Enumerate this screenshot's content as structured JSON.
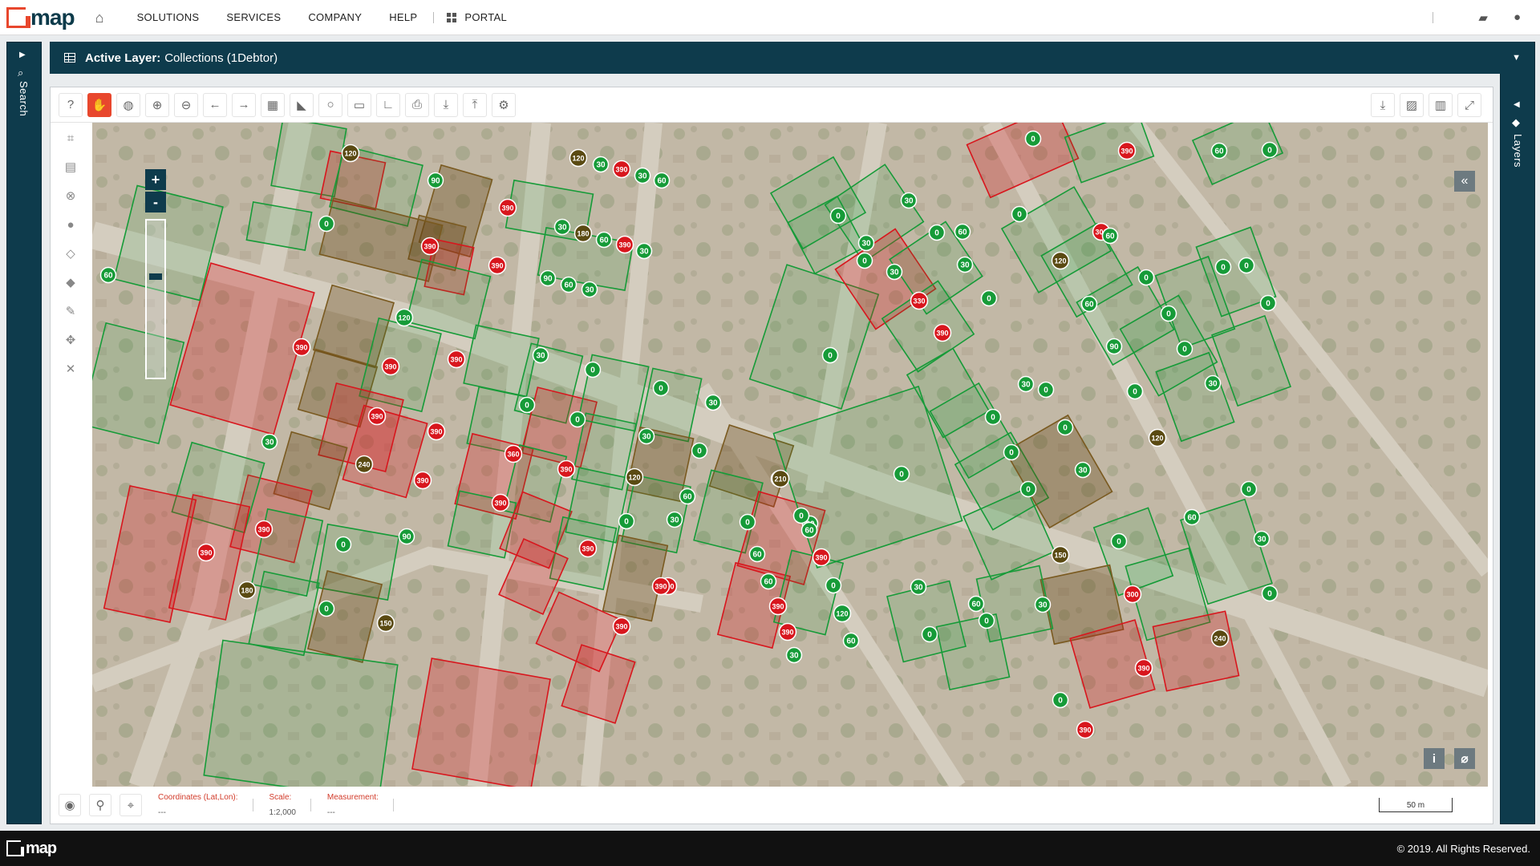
{
  "brand": {
    "name": "map"
  },
  "nav": {
    "items": [
      "SOLUTIONS",
      "SERVICES",
      "COMPANY",
      "HELP"
    ],
    "portal": "PORTAL"
  },
  "icons": {
    "home": "home-icon",
    "portal": "grid-icon",
    "chat": "chat-icon",
    "user": "user-icon",
    "search": "search-icon",
    "layers": "layers-icon"
  },
  "panels": {
    "search_label": "Search",
    "layers_label": "Layers"
  },
  "active_layer": {
    "prefix": "Active Layer:",
    "name": "Collections (1Debtor)"
  },
  "statusbar": {
    "coords_label": "Coordinates (Lat,Lon):",
    "coords_value": "---",
    "scale_label": "Scale:",
    "scale_value": "1:2,000",
    "measure_label": "Measurement:",
    "measure_value": "---",
    "scalebar_label": "50 m"
  },
  "footer": {
    "copyright": "© 2019. All Rights Reserved."
  },
  "colors": {
    "accent": "#e8472d",
    "panel": "#0e3b4c",
    "green": "#169b38",
    "red": "#d8161d",
    "olive": "#5a4a12"
  },
  "markers": [
    {
      "v": "120",
      "c": "o"
    },
    {
      "v": "0",
      "c": "g"
    },
    {
      "v": "90",
      "c": "g"
    },
    {
      "v": "390",
      "c": "r"
    },
    {
      "v": "390",
      "c": "r"
    },
    {
      "v": "390",
      "c": "r"
    },
    {
      "v": "120",
      "c": "o"
    },
    {
      "v": "30",
      "c": "g"
    },
    {
      "v": "390",
      "c": "r"
    },
    {
      "v": "30",
      "c": "g"
    },
    {
      "v": "60",
      "c": "g"
    },
    {
      "v": "30",
      "c": "g"
    },
    {
      "v": "180",
      "c": "o"
    },
    {
      "v": "60",
      "c": "g"
    },
    {
      "v": "390",
      "c": "r"
    },
    {
      "v": "30",
      "c": "g"
    },
    {
      "v": "90",
      "c": "g"
    },
    {
      "v": "60",
      "c": "g"
    },
    {
      "v": "30",
      "c": "g"
    },
    {
      "v": "60",
      "c": "g"
    },
    {
      "v": "120",
      "c": "g"
    },
    {
      "v": "390",
      "c": "r"
    },
    {
      "v": "390",
      "c": "r"
    },
    {
      "v": "390",
      "c": "r"
    },
    {
      "v": "30",
      "c": "g"
    },
    {
      "v": "0",
      "c": "g"
    },
    {
      "v": "0",
      "c": "g"
    },
    {
      "v": "0",
      "c": "g"
    },
    {
      "v": "390",
      "c": "r"
    },
    {
      "v": "30",
      "c": "g"
    },
    {
      "v": "390",
      "c": "r"
    },
    {
      "v": "360",
      "c": "r"
    },
    {
      "v": "390",
      "c": "r"
    },
    {
      "v": "240",
      "c": "o"
    },
    {
      "v": "390",
      "c": "r"
    },
    {
      "v": "0",
      "c": "g"
    },
    {
      "v": "30",
      "c": "g"
    },
    {
      "v": "390",
      "c": "r"
    },
    {
      "v": "30",
      "c": "g"
    },
    {
      "v": "0",
      "c": "g"
    },
    {
      "v": "120",
      "c": "o"
    },
    {
      "v": "60",
      "c": "g"
    },
    {
      "v": "30",
      "c": "g"
    },
    {
      "v": "0",
      "c": "g"
    },
    {
      "v": "90",
      "c": "g"
    },
    {
      "v": "390",
      "c": "r"
    },
    {
      "v": "390",
      "c": "r"
    },
    {
      "v": "390",
      "c": "r"
    },
    {
      "v": "180",
      "c": "o"
    },
    {
      "v": "390",
      "c": "r"
    },
    {
      "v": "390",
      "c": "r"
    },
    {
      "v": "390",
      "c": "r"
    },
    {
      "v": "0",
      "c": "g"
    },
    {
      "v": "60",
      "c": "g"
    },
    {
      "v": "0",
      "c": "g"
    },
    {
      "v": "150",
      "c": "o"
    },
    {
      "v": "0",
      "c": "g"
    },
    {
      "v": "210",
      "c": "o"
    },
    {
      "v": "0",
      "c": "g"
    },
    {
      "v": "60",
      "c": "g"
    },
    {
      "v": "0",
      "c": "g"
    },
    {
      "v": "60",
      "c": "g"
    },
    {
      "v": "390",
      "c": "r"
    },
    {
      "v": "60",
      "c": "g"
    },
    {
      "v": "0",
      "c": "g"
    },
    {
      "v": "390",
      "c": "r"
    },
    {
      "v": "120",
      "c": "g"
    },
    {
      "v": "390",
      "c": "r"
    },
    {
      "v": "60",
      "c": "g"
    },
    {
      "v": "30",
      "c": "g"
    },
    {
      "v": "0",
      "c": "g"
    },
    {
      "v": "30",
      "c": "g"
    },
    {
      "v": "0",
      "c": "g"
    },
    {
      "v": "30",
      "c": "g"
    },
    {
      "v": "60",
      "c": "g"
    },
    {
      "v": "30",
      "c": "g"
    },
    {
      "v": "0",
      "c": "g"
    },
    {
      "v": "30",
      "c": "g"
    },
    {
      "v": "300",
      "c": "r"
    },
    {
      "v": "0",
      "c": "g"
    },
    {
      "v": "330",
      "c": "r"
    },
    {
      "v": "390",
      "c": "r"
    },
    {
      "v": "0",
      "c": "g"
    },
    {
      "v": "0",
      "c": "g"
    },
    {
      "v": "0",
      "c": "g"
    },
    {
      "v": "60",
      "c": "g"
    },
    {
      "v": "390",
      "c": "r"
    },
    {
      "v": "0",
      "c": "g"
    },
    {
      "v": "0",
      "c": "g"
    },
    {
      "v": "60",
      "c": "g"
    },
    {
      "v": "120",
      "c": "o"
    },
    {
      "v": "0",
      "c": "g"
    },
    {
      "v": "60",
      "c": "g"
    },
    {
      "v": "0",
      "c": "g"
    },
    {
      "v": "90",
      "c": "g"
    },
    {
      "v": "0",
      "c": "g"
    },
    {
      "v": "0",
      "c": "g"
    },
    {
      "v": "0",
      "c": "g"
    },
    {
      "v": "0",
      "c": "g"
    },
    {
      "v": "30",
      "c": "g"
    },
    {
      "v": "0",
      "c": "g"
    },
    {
      "v": "30",
      "c": "g"
    },
    {
      "v": "0",
      "c": "g"
    },
    {
      "v": "0",
      "c": "g"
    },
    {
      "v": "0",
      "c": "g"
    },
    {
      "v": "120",
      "c": "o"
    },
    {
      "v": "0",
      "c": "g"
    },
    {
      "v": "30",
      "c": "g"
    },
    {
      "v": "0",
      "c": "g"
    },
    {
      "v": "150",
      "c": "o"
    },
    {
      "v": "0",
      "c": "g"
    },
    {
      "v": "0",
      "c": "g"
    },
    {
      "v": "60",
      "c": "g"
    },
    {
      "v": "30",
      "c": "g"
    },
    {
      "v": "300",
      "c": "r"
    },
    {
      "v": "0",
      "c": "g"
    },
    {
      "v": "390",
      "c": "r"
    },
    {
      "v": "240",
      "c": "o"
    },
    {
      "v": "30",
      "c": "g"
    },
    {
      "v": "60",
      "c": "g"
    },
    {
      "v": "30",
      "c": "g"
    },
    {
      "v": "0",
      "c": "g"
    },
    {
      "v": "0",
      "c": "g"
    },
    {
      "v": "390",
      "c": "r"
    },
    {
      "v": "0",
      "c": "g"
    }
  ]
}
